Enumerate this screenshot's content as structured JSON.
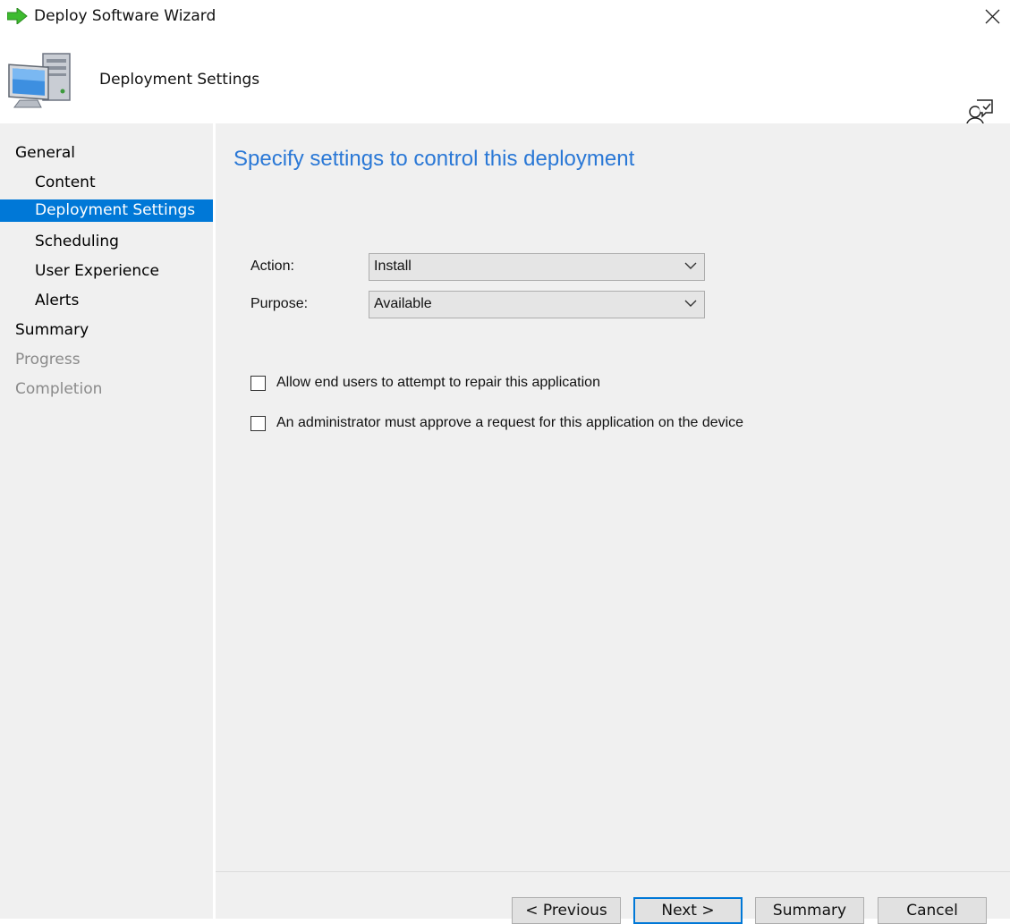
{
  "window": {
    "title": "Deploy Software Wizard",
    "icons": {
      "app": "green-arrow-icon",
      "close": "close-icon"
    }
  },
  "header": {
    "title": "Deployment Settings",
    "icons": {
      "page": "computer-icon",
      "help": "help-user-icon"
    }
  },
  "nav": {
    "items": [
      {
        "label": "General",
        "level": 0,
        "state": "normal"
      },
      {
        "label": "Content",
        "level": 1,
        "state": "normal"
      },
      {
        "label": "Deployment Settings",
        "level": 1,
        "state": "selected"
      },
      {
        "label": "Scheduling",
        "level": 1,
        "state": "normal"
      },
      {
        "label": "User Experience",
        "level": 1,
        "state": "normal"
      },
      {
        "label": "Alerts",
        "level": 1,
        "state": "normal"
      },
      {
        "label": "Summary",
        "level": 0,
        "state": "normal"
      },
      {
        "label": "Progress",
        "level": 0,
        "state": "disabled"
      },
      {
        "label": "Completion",
        "level": 0,
        "state": "disabled"
      }
    ]
  },
  "main": {
    "heading": "Specify settings to control this deployment",
    "action": {
      "label": "Action:",
      "value": "Install"
    },
    "purpose": {
      "label": "Purpose:",
      "value": "Available"
    },
    "checkboxes": [
      {
        "label": "Allow end users to attempt to repair this application",
        "checked": false
      },
      {
        "label": "An administrator must approve a request for this application on the device",
        "checked": false
      }
    ]
  },
  "footer": {
    "previous": "< Previous",
    "next": "Next >",
    "summary": "Summary",
    "cancel": "Cancel"
  },
  "colors": {
    "selection": "#0078d7",
    "heading": "#2a78d6",
    "panel_bg": "#f0f0f0",
    "disabled_text": "#8a8a8a"
  }
}
